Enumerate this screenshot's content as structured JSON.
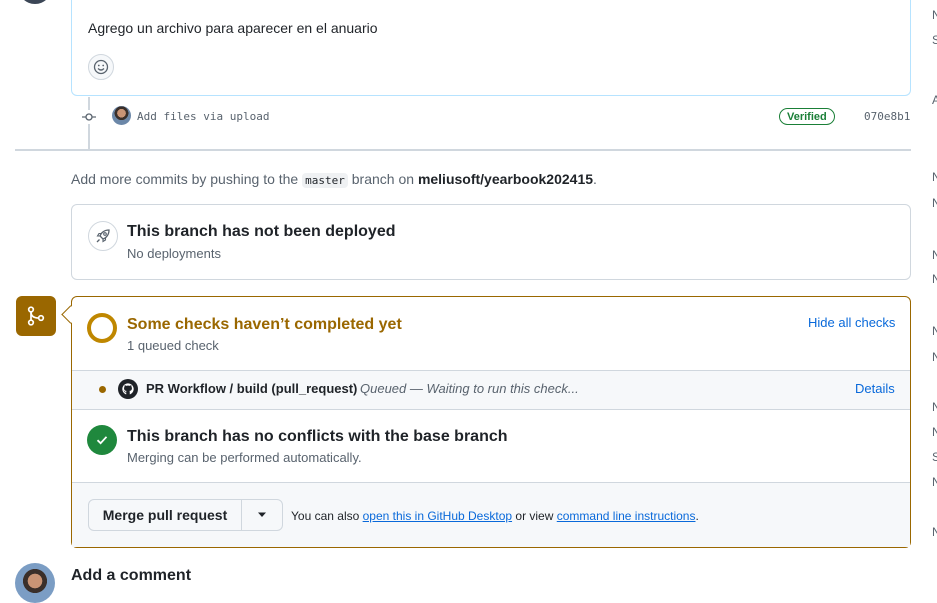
{
  "comment": {
    "body": "Agrego un archivo para aparecer en el anuario",
    "emoji_icon": "smiley-icon"
  },
  "commit": {
    "message": "Add files via upload",
    "badge": "Verified",
    "sha": "070e8b1"
  },
  "push_hint": {
    "prefix": "Add more commits by pushing to the",
    "branch": "master",
    "middle": "branch on",
    "repo": "meliusoft/yearbook202415",
    "suffix": "."
  },
  "deployment": {
    "title": "This branch has not been deployed",
    "subtitle": "No deployments"
  },
  "checks": {
    "title": "Some checks haven’t completed yet",
    "subtitle": "1 queued check",
    "toggle_label": "Hide all checks",
    "items": [
      {
        "name": "PR Workflow / build (pull_request)",
        "status": "Queued — Waiting to run this check...",
        "action": "Details"
      }
    ]
  },
  "conflicts": {
    "title": "This branch has no conflicts with the base branch",
    "subtitle": "Merging can be performed automatically."
  },
  "merge": {
    "button_label": "Merge pull request",
    "alt_prefix": "You can also",
    "desktop_link": "open this in GitHub Desktop",
    "alt_middle": "or view",
    "cli_link": "command line instructions",
    "alt_suffix": "."
  },
  "add_comment": {
    "title": "Add a comment"
  },
  "sidebar_fragments": [
    "N",
    "S",
    "A",
    "N",
    "N",
    "N",
    "N",
    "N",
    "N",
    "N",
    "N",
    "S",
    "N",
    "N"
  ],
  "colors": {
    "accent_link": "#0969da",
    "pending": "#9a6700",
    "success": "#1f883d",
    "border": "#d0d7de"
  }
}
